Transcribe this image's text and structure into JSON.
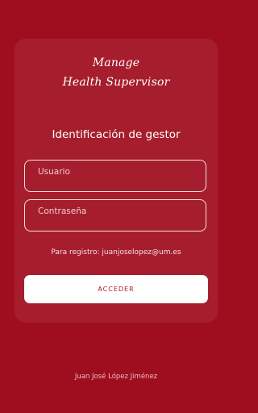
{
  "logo": {
    "line1": "Manage",
    "line2": "Health Supervisor"
  },
  "login": {
    "title": "Identificación de gestor",
    "username_placeholder": "Usuario",
    "password_placeholder": "Contraseña",
    "register_hint": "Para registro: juanjoselopez@um.es",
    "submit_label": "ACCEDER"
  },
  "footer": {
    "author": "Juan José López Jiménez"
  },
  "colors": {
    "background": "#9f0e1e",
    "card": "#a61e2d",
    "button": "#ffffff",
    "button_text": "#b01627"
  }
}
